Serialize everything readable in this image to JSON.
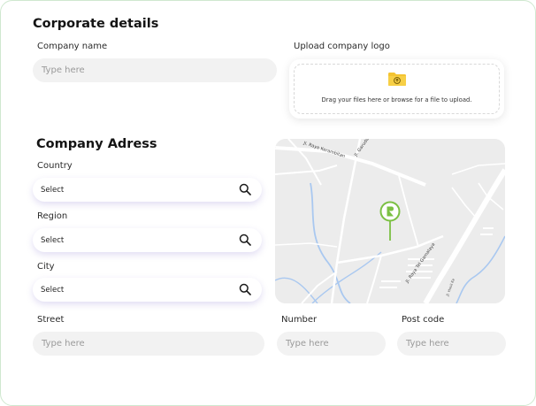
{
  "corporate": {
    "title": "Corporate details",
    "company_name_label": "Company name",
    "company_name_placeholder": "Type here",
    "upload_label": "Upload company logo",
    "upload_hint": "Drag your files here or browse for a file to upload."
  },
  "address": {
    "title": "Company Adress",
    "country_label": "Country",
    "country_value": "Select",
    "region_label": "Region",
    "region_value": "Select",
    "city_label": "City",
    "city_value": "Select",
    "street_label": "Street",
    "street_placeholder": "Type here",
    "number_label": "Number",
    "number_placeholder": "Type here",
    "postcode_label": "Post code",
    "postcode_placeholder": "Type here"
  },
  "map": {
    "street_names": [
      "Jl. Raya Kerambitan",
      "Jl. Garuda",
      "Jl. Raya Tel Gamalaya",
      "Jl. Hasil Ke"
    ],
    "pin_color": "#7bc043",
    "road_color": "#ffffff",
    "water_color": "#a9c8f0"
  },
  "icons": {
    "search": "search-icon",
    "folder": "folder-upload-icon",
    "pin": "map-pin-icon"
  }
}
